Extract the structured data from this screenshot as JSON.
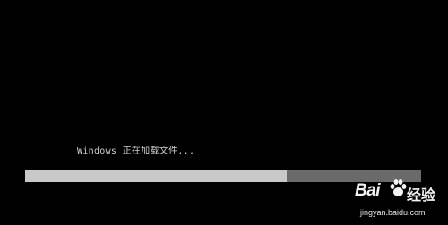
{
  "boot": {
    "status_text": "Windows 正在加载文件...",
    "progress_fraction": 0.66
  },
  "watermark": {
    "logo_text_left": "Bai",
    "logo_text_right": "经验",
    "url": "jingyan.baidu.com"
  },
  "colors": {
    "background": "#000000",
    "text": "#d0d0d0",
    "progress_fill": "#c8c8c8",
    "progress_track": "#6a6a6a"
  }
}
